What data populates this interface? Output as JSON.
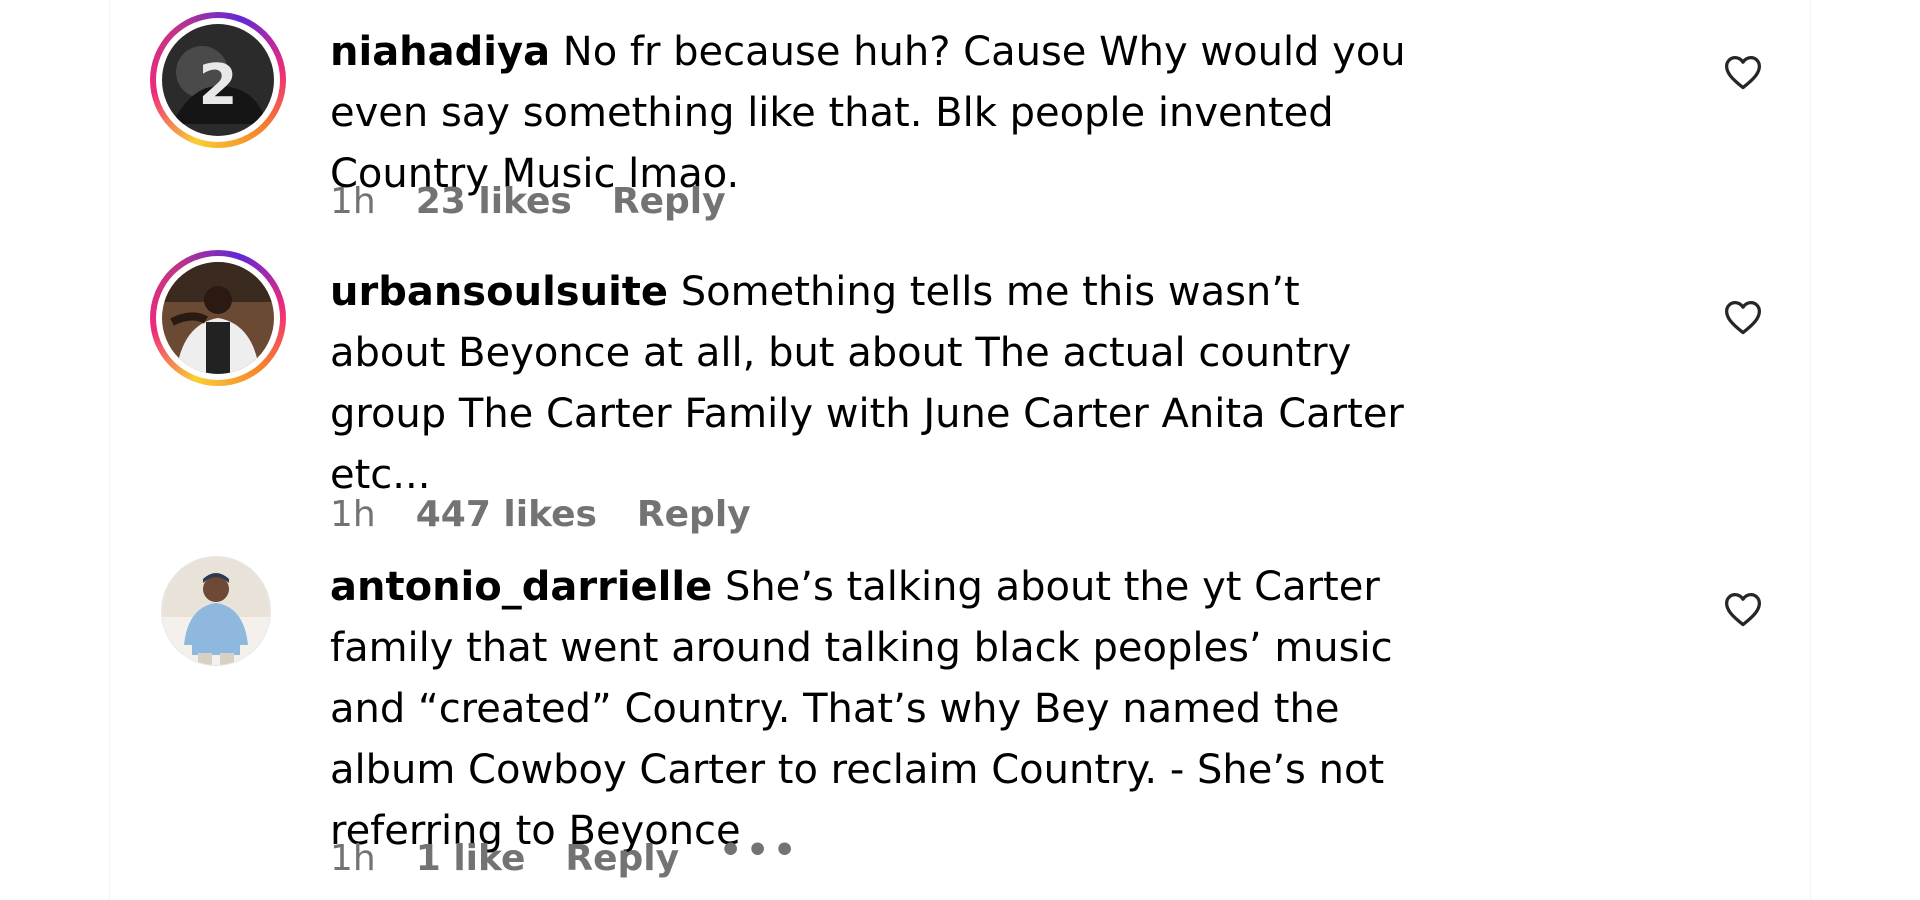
{
  "comments": [
    {
      "username": "niahadiya",
      "text": "No fr because huh? Cause Why would you even say something like that. Blk people invented Country Music lmao.",
      "time": "1h",
      "likes": "23 likes",
      "reply": "Reply",
      "avatar_story_ring": true
    },
    {
      "username": "urbansoulsuite",
      "text": "Something tells me this wasn’t about Beyonce at all, but about The actual country group The Carter Family with June Carter Anita Carter etc...",
      "time": "1h",
      "likes": "447 likes",
      "reply": "Reply",
      "avatar_story_ring": true
    },
    {
      "username": "antonio_darrielle",
      "text": "She’s talking about the yt Carter family that went around talking black peoples’ music and “created” Country. That’s why Bey named the album Cowboy Carter to reclaim Country. - She’s not referring to Beyonce",
      "time": "1h",
      "likes": "1 like",
      "reply": "Reply",
      "more": "•••",
      "avatar_story_ring": false
    }
  ],
  "icons": {
    "like": "heart-outline-icon",
    "more": "more-horizontal-icon"
  },
  "colors": {
    "text": "#000000",
    "meta": "#737373",
    "ring_gradient": [
      "#f9ce34",
      "#ee2a7b",
      "#6228d7"
    ]
  }
}
